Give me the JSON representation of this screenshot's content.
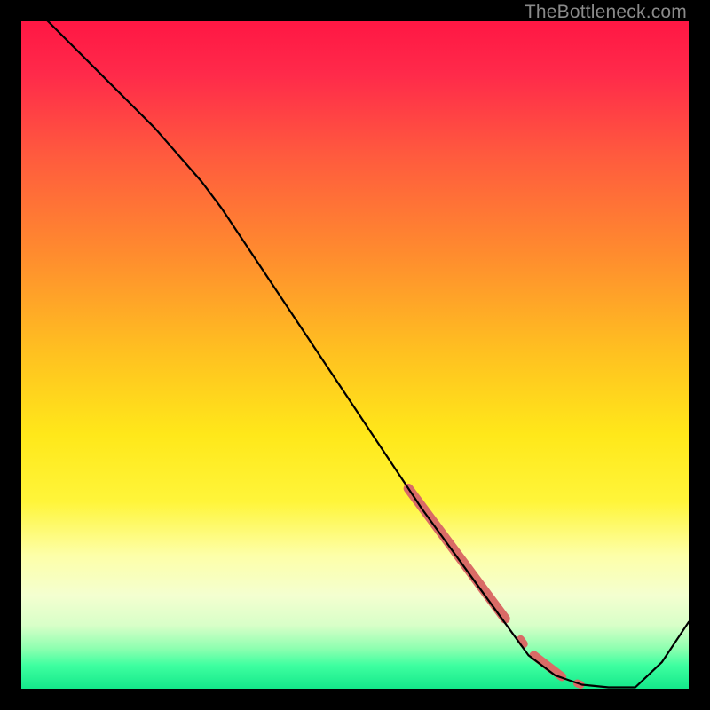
{
  "watermark": "TheBottleneck.com",
  "chart_data": {
    "type": "line",
    "title": "",
    "xlabel": "",
    "ylabel": "",
    "xlim": [
      0,
      100
    ],
    "ylim": [
      0,
      100
    ],
    "grid": false,
    "legend": false,
    "gradient_stops": [
      {
        "offset": 0.0,
        "color": "#ff1744"
      },
      {
        "offset": 0.08,
        "color": "#ff2a4a"
      },
      {
        "offset": 0.2,
        "color": "#ff5a3e"
      },
      {
        "offset": 0.35,
        "color": "#ff8c2e"
      },
      {
        "offset": 0.5,
        "color": "#ffc220"
      },
      {
        "offset": 0.62,
        "color": "#ffe81a"
      },
      {
        "offset": 0.72,
        "color": "#fff53a"
      },
      {
        "offset": 0.8,
        "color": "#fdffa8"
      },
      {
        "offset": 0.86,
        "color": "#f4ffd0"
      },
      {
        "offset": 0.905,
        "color": "#d8ffc8"
      },
      {
        "offset": 0.94,
        "color": "#8dffb0"
      },
      {
        "offset": 0.965,
        "color": "#3effa0"
      },
      {
        "offset": 1.0,
        "color": "#14e88a"
      }
    ],
    "series": [
      {
        "name": "bottleneck-curve",
        "color": "#000000",
        "width": 2.2,
        "x": [
          0,
          5,
          12,
          20,
          27,
          30,
          36,
          44,
          52,
          60,
          68,
          76,
          80,
          84,
          88,
          92,
          96,
          100
        ],
        "y": [
          104,
          99,
          92,
          84,
          76,
          72,
          63,
          51,
          39,
          27,
          16,
          5,
          2,
          0.6,
          0.2,
          0.2,
          4,
          10
        ]
      }
    ],
    "highlight_segments": [
      {
        "name": "thick-segment-1",
        "color": "#d96b66",
        "width": 11,
        "cap": "round",
        "x": [
          58,
          72.5
        ],
        "y": [
          30,
          10.5
        ]
      },
      {
        "name": "dot-1",
        "color": "#d96b66",
        "width": 9,
        "cap": "round",
        "x": [
          74.8,
          75.3
        ],
        "y": [
          7.4,
          6.7
        ]
      },
      {
        "name": "thick-segment-2",
        "color": "#d96b66",
        "width": 10,
        "cap": "round",
        "x": [
          76.8,
          81
        ],
        "y": [
          5,
          1.8
        ]
      },
      {
        "name": "dot-2",
        "color": "#d96b66",
        "width": 9,
        "cap": "round",
        "x": [
          83.3,
          83.8
        ],
        "y": [
          0.8,
          0.6
        ]
      }
    ]
  }
}
